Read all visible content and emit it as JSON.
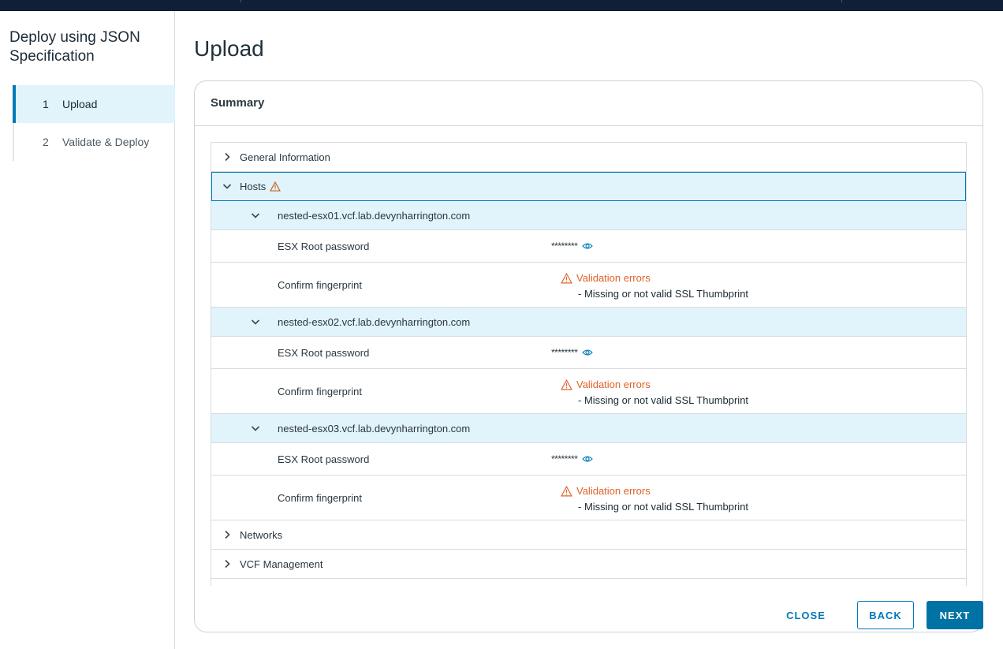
{
  "sidebar": {
    "title": "Deploy using JSON Specification",
    "steps": [
      {
        "num": "1",
        "label": "Upload"
      },
      {
        "num": "2",
        "label": "Validate & Deploy"
      }
    ]
  },
  "main": {
    "page_title": "Upload",
    "summary_title": "Summary"
  },
  "tree": {
    "general": "General Information",
    "hosts": "Hosts",
    "host_list": [
      {
        "name": "nested-esx01.vcf.lab.devynharrington.com"
      },
      {
        "name": "nested-esx02.vcf.lab.devynharrington.com"
      },
      {
        "name": "nested-esx03.vcf.lab.devynharrington.com"
      }
    ],
    "password_label": "ESX Root password",
    "password_value": "********",
    "fingerprint_label": "Confirm fingerprint",
    "error_title": "Validation errors",
    "error_message": "- Missing or not valid SSL Thumbprint",
    "networks": "Networks",
    "vcf_management": "VCF Management"
  },
  "footer": {
    "close": "CLOSE",
    "back": "BACK",
    "next": "NEXT"
  },
  "colors": {
    "accent": "#0079b8",
    "highlight": "#e1f3fb",
    "warning": "#e0622a",
    "topbar": "#0e1f36"
  }
}
